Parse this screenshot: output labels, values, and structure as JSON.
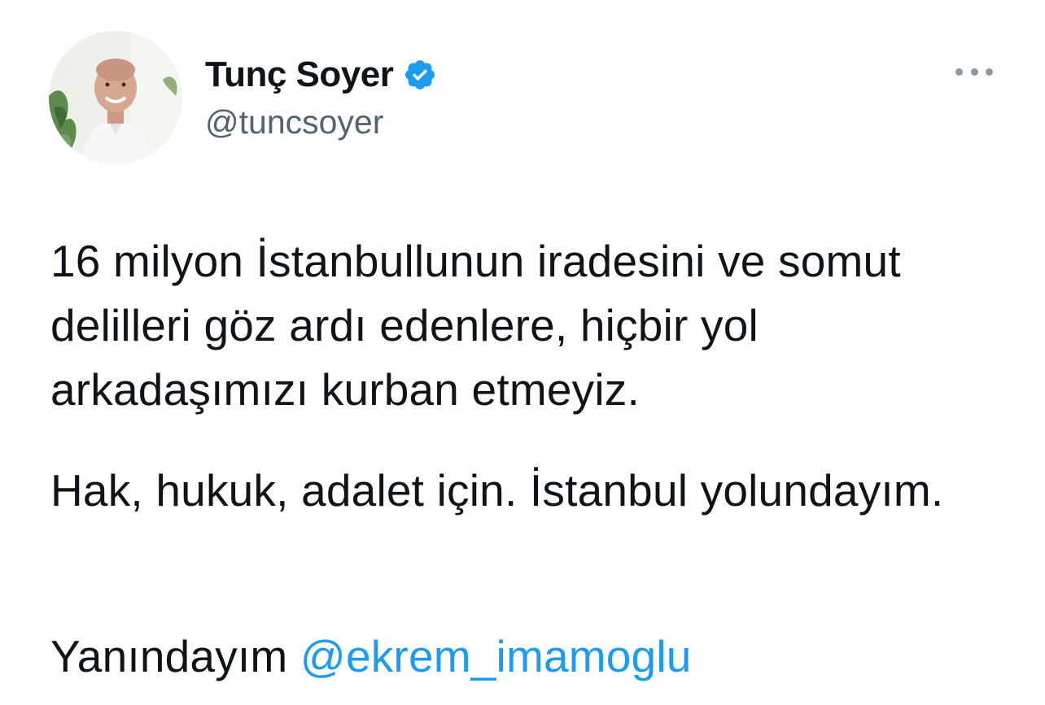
{
  "author": {
    "display_name": "Tunç Soyer",
    "handle": "@tuncsoyer",
    "verified": true,
    "verified_icon": "verified-badge-icon",
    "avatar_icon": "profile-photo"
  },
  "menu": {
    "icon": "more-options-icon"
  },
  "tweet": {
    "paragraph_1": "16 milyon İstanbullunun iradesini ve somut delilleri göz ardı edenlere, hiçbir yol arkadaşımızı kurban etmeyiz.",
    "paragraph_2": "Hak, hukuk, adalet için. İstanbul yolundayım.",
    "paragraph_3_text": "Yanındayım ",
    "paragraph_3_mention": "@ekrem_imamoglu"
  },
  "colors": {
    "text": "#0f1419",
    "secondary": "#536471",
    "accent": "#1d9bf0"
  }
}
